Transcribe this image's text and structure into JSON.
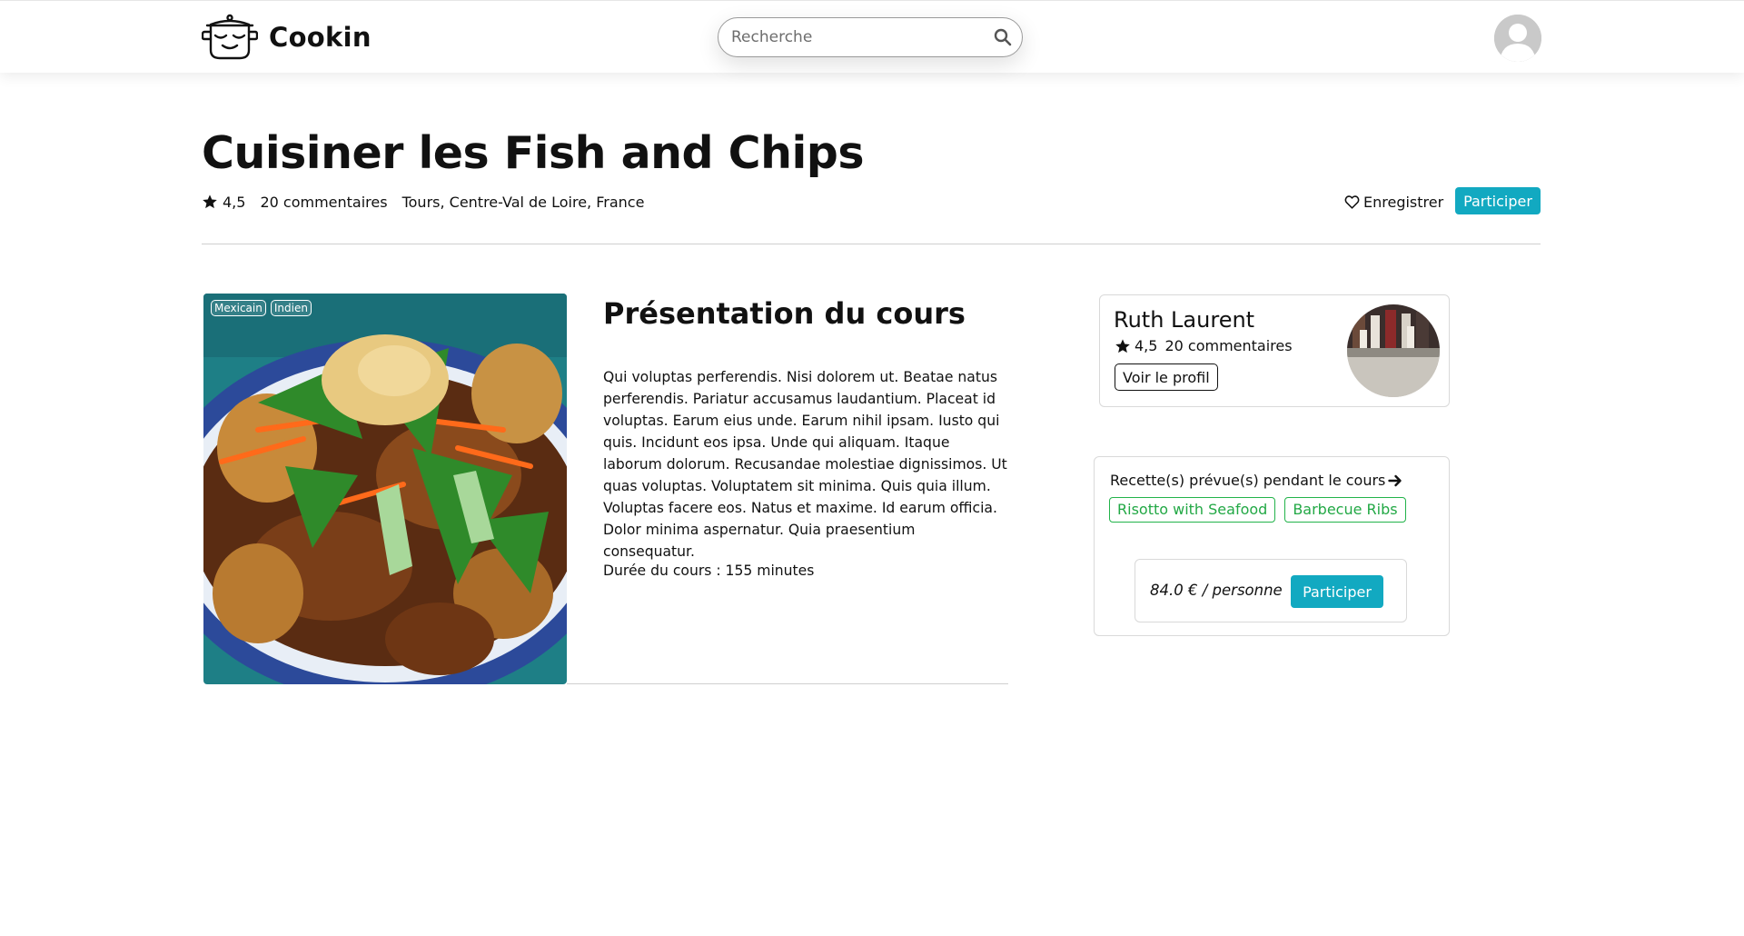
{
  "app": {
    "name": "Cookin",
    "brand_color": "#12a9c1"
  },
  "search": {
    "placeholder": "Recherche"
  },
  "course": {
    "title": "Cuisiner les Fish and Chips",
    "rating": "4,5",
    "comments": "20 commentaires",
    "location": "Tours, Centre-Val de Loire, France",
    "save_label": "Enregistrer",
    "participate_label": "Participer",
    "tags": [
      "Mexicain",
      "Indien"
    ],
    "section_title": "Présentation du cours",
    "description": "Qui voluptas perferendis. Nisi dolorem ut. Beatae natus perferendis. Pariatur accusamus laudantium. Placeat id voluptas. Earum eius unde. Earum nihil ipsam. Iusto qui quis. Incidunt eos ipsa. Unde qui aliquam. Itaque laborum dolorum. Recusandae molestiae dignissimos. Ut quas voluptas. Voluptatem sit minima. Quis quia illum. Voluptas facere eos. Natus et maxime. Id earum officia. Dolor minima aspernatur. Quia praesentium consequatur.",
    "duration": "Durée du cours : 155 minutes"
  },
  "chef": {
    "name": "Ruth Laurent",
    "rating": "4,5",
    "comments": "20 commentaires",
    "profile_label": "Voir le profil"
  },
  "recipes": {
    "heading": "Recette(s) prévue(s) pendant le cours",
    "items": [
      "Risotto with Seafood",
      "Barbecue Ribs"
    ],
    "price": "84.0 € / personne",
    "participate_label": "Participer"
  },
  "icons": {
    "logo": "cooking-pot-face-icon",
    "search": "search-icon",
    "star": "star-icon",
    "heart": "heart-icon",
    "arrow": "arrow-right-icon",
    "user": "user-avatar-icon"
  }
}
